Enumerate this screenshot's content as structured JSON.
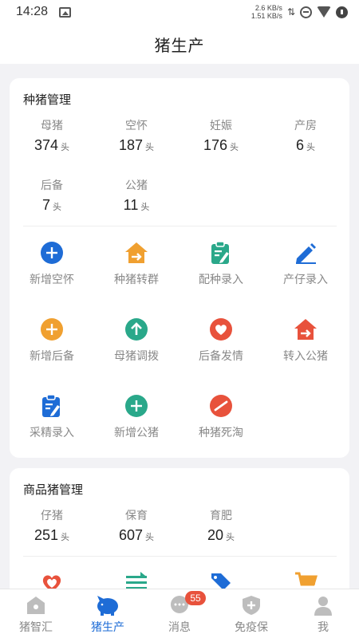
{
  "status_bar": {
    "time": "14:28",
    "net_up": "2.6 KB/s",
    "net_down": "1.51 KB/s"
  },
  "header": {
    "title": "猪生产"
  },
  "breeding_card": {
    "title": "种猪管理",
    "stats": [
      {
        "label": "母猪",
        "value": "374",
        "unit": "头"
      },
      {
        "label": "空怀",
        "value": "187",
        "unit": "头"
      },
      {
        "label": "妊娠",
        "value": "176",
        "unit": "头"
      },
      {
        "label": "产房",
        "value": "6",
        "unit": "头"
      },
      {
        "label": "后备",
        "value": "7",
        "unit": "头"
      },
      {
        "label": "公猪",
        "value": "11",
        "unit": "头"
      }
    ],
    "actions": [
      {
        "label": "新增空怀",
        "icon": "plus-circle-icon",
        "color": "#1e6cd6"
      },
      {
        "label": "种猪转群",
        "icon": "house-transfer-icon",
        "color": "#f0a030"
      },
      {
        "label": "配种录入",
        "icon": "clipboard-edit-icon",
        "color": "#2aa88a"
      },
      {
        "label": "产仔录入",
        "icon": "pencil-icon",
        "color": "#1e6cd6"
      },
      {
        "label": "新增后备",
        "icon": "plus-circle-icon",
        "color": "#f0a030"
      },
      {
        "label": "母猪调拨",
        "icon": "arrow-up-circle-icon",
        "color": "#2aa88a"
      },
      {
        "label": "后备发情",
        "icon": "heart-circle-icon",
        "color": "#e8523c"
      },
      {
        "label": "转入公猪",
        "icon": "house-transfer-icon",
        "color": "#e8523c"
      },
      {
        "label": "采精录入",
        "icon": "clipboard-edit-icon",
        "color": "#1e6cd6"
      },
      {
        "label": "新增公猪",
        "icon": "plus-circle-icon",
        "color": "#2aa88a"
      },
      {
        "label": "种猪死淘",
        "icon": "slash-circle-icon",
        "color": "#e8523c"
      }
    ]
  },
  "commercial_card": {
    "title": "商品猪管理",
    "stats": [
      {
        "label": "仔猪",
        "value": "251",
        "unit": "头"
      },
      {
        "label": "保育",
        "value": "607",
        "unit": "头"
      },
      {
        "label": "育肥",
        "value": "20",
        "unit": "头"
      }
    ]
  },
  "bottom_nav": {
    "items": [
      {
        "label": "猪智汇"
      },
      {
        "label": "猪生产"
      },
      {
        "label": "消息",
        "badge": "55"
      },
      {
        "label": "免疫保"
      },
      {
        "label": "我"
      }
    ]
  }
}
